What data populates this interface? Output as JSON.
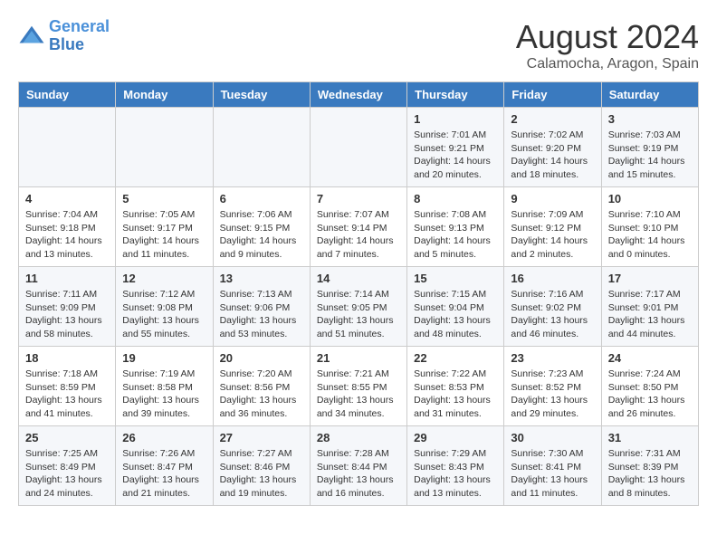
{
  "header": {
    "logo_line1": "General",
    "logo_line2": "Blue",
    "month_year": "August 2024",
    "location": "Calamocha, Aragon, Spain"
  },
  "weekdays": [
    "Sunday",
    "Monday",
    "Tuesday",
    "Wednesday",
    "Thursday",
    "Friday",
    "Saturday"
  ],
  "weeks": [
    [
      {
        "day": "",
        "info": ""
      },
      {
        "day": "",
        "info": ""
      },
      {
        "day": "",
        "info": ""
      },
      {
        "day": "",
        "info": ""
      },
      {
        "day": "1",
        "info": "Sunrise: 7:01 AM\nSunset: 9:21 PM\nDaylight: 14 hours\nand 20 minutes."
      },
      {
        "day": "2",
        "info": "Sunrise: 7:02 AM\nSunset: 9:20 PM\nDaylight: 14 hours\nand 18 minutes."
      },
      {
        "day": "3",
        "info": "Sunrise: 7:03 AM\nSunset: 9:19 PM\nDaylight: 14 hours\nand 15 minutes."
      }
    ],
    [
      {
        "day": "4",
        "info": "Sunrise: 7:04 AM\nSunset: 9:18 PM\nDaylight: 14 hours\nand 13 minutes."
      },
      {
        "day": "5",
        "info": "Sunrise: 7:05 AM\nSunset: 9:17 PM\nDaylight: 14 hours\nand 11 minutes."
      },
      {
        "day": "6",
        "info": "Sunrise: 7:06 AM\nSunset: 9:15 PM\nDaylight: 14 hours\nand 9 minutes."
      },
      {
        "day": "7",
        "info": "Sunrise: 7:07 AM\nSunset: 9:14 PM\nDaylight: 14 hours\nand 7 minutes."
      },
      {
        "day": "8",
        "info": "Sunrise: 7:08 AM\nSunset: 9:13 PM\nDaylight: 14 hours\nand 5 minutes."
      },
      {
        "day": "9",
        "info": "Sunrise: 7:09 AM\nSunset: 9:12 PM\nDaylight: 14 hours\nand 2 minutes."
      },
      {
        "day": "10",
        "info": "Sunrise: 7:10 AM\nSunset: 9:10 PM\nDaylight: 14 hours\nand 0 minutes."
      }
    ],
    [
      {
        "day": "11",
        "info": "Sunrise: 7:11 AM\nSunset: 9:09 PM\nDaylight: 13 hours\nand 58 minutes."
      },
      {
        "day": "12",
        "info": "Sunrise: 7:12 AM\nSunset: 9:08 PM\nDaylight: 13 hours\nand 55 minutes."
      },
      {
        "day": "13",
        "info": "Sunrise: 7:13 AM\nSunset: 9:06 PM\nDaylight: 13 hours\nand 53 minutes."
      },
      {
        "day": "14",
        "info": "Sunrise: 7:14 AM\nSunset: 9:05 PM\nDaylight: 13 hours\nand 51 minutes."
      },
      {
        "day": "15",
        "info": "Sunrise: 7:15 AM\nSunset: 9:04 PM\nDaylight: 13 hours\nand 48 minutes."
      },
      {
        "day": "16",
        "info": "Sunrise: 7:16 AM\nSunset: 9:02 PM\nDaylight: 13 hours\nand 46 minutes."
      },
      {
        "day": "17",
        "info": "Sunrise: 7:17 AM\nSunset: 9:01 PM\nDaylight: 13 hours\nand 44 minutes."
      }
    ],
    [
      {
        "day": "18",
        "info": "Sunrise: 7:18 AM\nSunset: 8:59 PM\nDaylight: 13 hours\nand 41 minutes."
      },
      {
        "day": "19",
        "info": "Sunrise: 7:19 AM\nSunset: 8:58 PM\nDaylight: 13 hours\nand 39 minutes."
      },
      {
        "day": "20",
        "info": "Sunrise: 7:20 AM\nSunset: 8:56 PM\nDaylight: 13 hours\nand 36 minutes."
      },
      {
        "day": "21",
        "info": "Sunrise: 7:21 AM\nSunset: 8:55 PM\nDaylight: 13 hours\nand 34 minutes."
      },
      {
        "day": "22",
        "info": "Sunrise: 7:22 AM\nSunset: 8:53 PM\nDaylight: 13 hours\nand 31 minutes."
      },
      {
        "day": "23",
        "info": "Sunrise: 7:23 AM\nSunset: 8:52 PM\nDaylight: 13 hours\nand 29 minutes."
      },
      {
        "day": "24",
        "info": "Sunrise: 7:24 AM\nSunset: 8:50 PM\nDaylight: 13 hours\nand 26 minutes."
      }
    ],
    [
      {
        "day": "25",
        "info": "Sunrise: 7:25 AM\nSunset: 8:49 PM\nDaylight: 13 hours\nand 24 minutes."
      },
      {
        "day": "26",
        "info": "Sunrise: 7:26 AM\nSunset: 8:47 PM\nDaylight: 13 hours\nand 21 minutes."
      },
      {
        "day": "27",
        "info": "Sunrise: 7:27 AM\nSunset: 8:46 PM\nDaylight: 13 hours\nand 19 minutes."
      },
      {
        "day": "28",
        "info": "Sunrise: 7:28 AM\nSunset: 8:44 PM\nDaylight: 13 hours\nand 16 minutes."
      },
      {
        "day": "29",
        "info": "Sunrise: 7:29 AM\nSunset: 8:43 PM\nDaylight: 13 hours\nand 13 minutes."
      },
      {
        "day": "30",
        "info": "Sunrise: 7:30 AM\nSunset: 8:41 PM\nDaylight: 13 hours\nand 11 minutes."
      },
      {
        "day": "31",
        "info": "Sunrise: 7:31 AM\nSunset: 8:39 PM\nDaylight: 13 hours\nand 8 minutes."
      }
    ]
  ]
}
